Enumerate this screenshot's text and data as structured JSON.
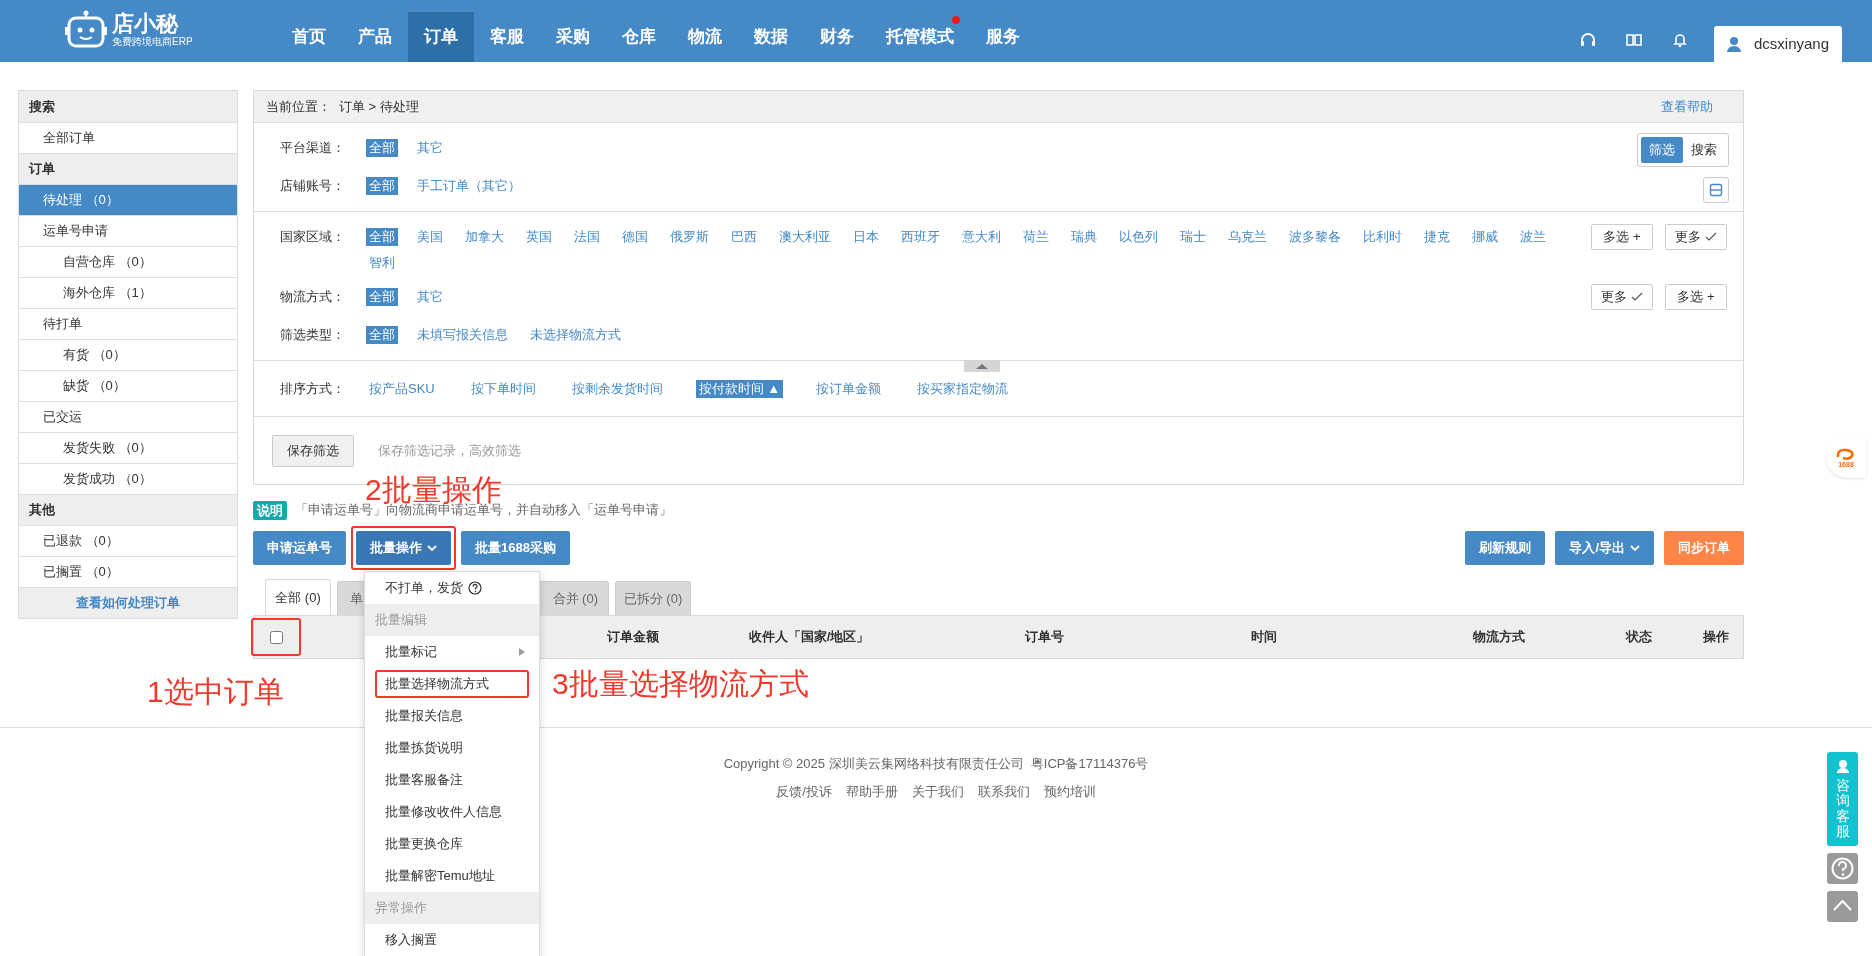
{
  "header": {
    "logo": {
      "name": "店小秘",
      "tagline": "免费跨境电商ERP"
    },
    "nav": [
      {
        "label": "首页",
        "selected": false,
        "dot": false
      },
      {
        "label": "产品",
        "selected": false,
        "dot": false
      },
      {
        "label": "订单",
        "selected": true,
        "dot": false
      },
      {
        "label": "客服",
        "selected": false,
        "dot": false
      },
      {
        "label": "采购",
        "selected": false,
        "dot": false
      },
      {
        "label": "仓库",
        "selected": false,
        "dot": false
      },
      {
        "label": "物流",
        "selected": false,
        "dot": false
      },
      {
        "label": "数据",
        "selected": false,
        "dot": false
      },
      {
        "label": "财务",
        "selected": false,
        "dot": false
      },
      {
        "label": "托管模式",
        "selected": false,
        "dot": true
      },
      {
        "label": "服务",
        "selected": false,
        "dot": false
      }
    ],
    "user": "dcsxinyang"
  },
  "sidebar": {
    "sections": [
      {
        "title": "搜索",
        "items": [
          {
            "label": "全部订单",
            "selected": false
          }
        ]
      },
      {
        "title": "订单",
        "items": [
          {
            "label": "待处理 （0）",
            "selected": true
          },
          {
            "label": "运单号申请",
            "selected": false,
            "children": [
              {
                "label": "自营仓库 （0）",
                "selected": false
              },
              {
                "label": "海外仓库 （1）",
                "selected": false
              }
            ]
          },
          {
            "label": "待打单",
            "selected": false,
            "children": [
              {
                "label": "有货 （0）",
                "selected": false
              },
              {
                "label": "缺货 （0）",
                "selected": false
              }
            ]
          },
          {
            "label": "已交运",
            "selected": false,
            "children": [
              {
                "label": "发货失败 （0）",
                "selected": false
              },
              {
                "label": "发货成功 （0）",
                "selected": false
              }
            ]
          }
        ]
      },
      {
        "title": "其他",
        "items": [
          {
            "label": "已退款 （0）",
            "selected": false
          },
          {
            "label": "已搁置 （0）",
            "selected": false
          }
        ]
      }
    ],
    "help_link": "查看如何处理订单"
  },
  "breadcrumb": {
    "label": "当前位置：",
    "path": "订单 > 待处理",
    "help": "查看帮助"
  },
  "view_toggle": [
    {
      "label": "筛选",
      "selected": true
    },
    {
      "label": "搜索",
      "selected": false
    }
  ],
  "filter_groups": [
    [
      {
        "label": "平台渠道：",
        "options": [
          {
            "label": "全部",
            "selected": true
          },
          {
            "label": "其它",
            "selected": false
          }
        ]
      },
      {
        "label": "店铺账号：",
        "options": [
          {
            "label": "全部",
            "selected": true
          },
          {
            "label": "手工订单（其它）",
            "selected": false
          }
        ]
      }
    ],
    [
      {
        "label": "国家区域：",
        "options": [
          {
            "label": "全部",
            "selected": true
          },
          {
            "label": "美国",
            "selected": false
          },
          {
            "label": "加拿大",
            "selected": false
          },
          {
            "label": "英国",
            "selected": false
          },
          {
            "label": "法国",
            "selected": false
          },
          {
            "label": "德国",
            "selected": false
          },
          {
            "label": "俄罗斯",
            "selected": false
          },
          {
            "label": "巴西",
            "selected": false
          },
          {
            "label": "澳大利亚",
            "selected": false
          },
          {
            "label": "日本",
            "selected": false
          },
          {
            "label": "西班牙",
            "selected": false
          },
          {
            "label": "意大利",
            "selected": false
          },
          {
            "label": "荷兰",
            "selected": false
          },
          {
            "label": "瑞典",
            "selected": false
          },
          {
            "label": "以色列",
            "selected": false
          },
          {
            "label": "瑞士",
            "selected": false
          },
          {
            "label": "乌克兰",
            "selected": false
          },
          {
            "label": "波多黎各",
            "selected": false
          },
          {
            "label": "比利时",
            "selected": false
          },
          {
            "label": "捷克",
            "selected": false
          },
          {
            "label": "挪威",
            "selected": false
          },
          {
            "label": "波兰",
            "selected": false
          },
          {
            "label": "智利",
            "selected": false
          }
        ],
        "buttons": [
          {
            "label": "多选 +",
            "kind": "multi"
          },
          {
            "label": "更多",
            "kind": "more"
          }
        ]
      },
      {
        "label": "物流方式：",
        "options": [
          {
            "label": "全部",
            "selected": true
          },
          {
            "label": "其它",
            "selected": false
          }
        ],
        "buttons": [
          {
            "label": "更多",
            "kind": "more"
          },
          {
            "label": "多选 +",
            "kind": "multi"
          }
        ]
      },
      {
        "label": "筛选类型：",
        "options": [
          {
            "label": "全部",
            "selected": true
          },
          {
            "label": "未填写报关信息",
            "selected": false
          },
          {
            "label": "未选择物流方式",
            "selected": false
          }
        ]
      }
    ]
  ],
  "sort": {
    "label": "排序方式：",
    "options": [
      {
        "label": "按产品SKU",
        "selected": false
      },
      {
        "label": "按下单时间",
        "selected": false
      },
      {
        "label": "按剩余发货时间",
        "selected": false
      },
      {
        "label": "按付款时间 ▲",
        "selected": true
      },
      {
        "label": "按订单金额",
        "selected": false
      },
      {
        "label": "按买家指定物流",
        "selected": false
      }
    ]
  },
  "save_filter": {
    "button": "保存筛选",
    "hint": "保存筛选记录，高效筛选"
  },
  "notice": {
    "tag": "说明",
    "text": "「申请运单号」向物流商申请运单号，并自动移入「运单号申请」"
  },
  "actions_left": [
    {
      "label": "申请运单号",
      "kind": "plain",
      "highlighted": false
    },
    {
      "label": "批量操作",
      "kind": "dropdown",
      "highlighted": true
    },
    {
      "label": "批量1688采购",
      "kind": "plain",
      "highlighted": false
    }
  ],
  "actions_right": [
    {
      "label": "刷新规则",
      "kind": "plain",
      "highlighted": false
    },
    {
      "label": "导入/导出",
      "kind": "dropdown",
      "highlighted": false
    },
    {
      "label": "同步订单",
      "kind": "accent",
      "highlighted": false
    }
  ],
  "tabs": [
    {
      "label": "全部 (0)",
      "selected": true
    },
    {
      "label": "单",
      "selected": false
    },
    {
      "label": "合并 (0)",
      "selected": false
    },
    {
      "label": "已拆分 (0)",
      "selected": false
    }
  ],
  "table": {
    "select_all": {
      "checked": false,
      "highlighted": true
    },
    "columns": [
      "订单金额",
      "收件人「国家/地区」",
      "订单号",
      "时间",
      "物流方式",
      "状态",
      "操作"
    ]
  },
  "dropdown_menu": [
    {
      "kind": "item",
      "label": "不打单，发货",
      "help": true,
      "submenu": false,
      "highlighted": false
    },
    {
      "kind": "header",
      "label": "批量编辑"
    },
    {
      "kind": "item",
      "label": "批量标记",
      "help": false,
      "submenu": true,
      "highlighted": false
    },
    {
      "kind": "item",
      "label": "批量选择物流方式",
      "help": false,
      "submenu": false,
      "highlighted": true
    },
    {
      "kind": "item",
      "label": "批量报关信息",
      "help": false,
      "submenu": false,
      "highlighted": false
    },
    {
      "kind": "item",
      "label": "批量拣货说明",
      "help": false,
      "submenu": false,
      "highlighted": false
    },
    {
      "kind": "item",
      "label": "批量客服备注",
      "help": false,
      "submenu": false,
      "highlighted": false
    },
    {
      "kind": "item",
      "label": "批量修改收件人信息",
      "help": false,
      "submenu": false,
      "highlighted": false
    },
    {
      "kind": "item",
      "label": "批量更换仓库",
      "help": false,
      "submenu": false,
      "highlighted": false
    },
    {
      "kind": "item",
      "label": "批量解密Temu地址",
      "help": false,
      "submenu": false,
      "highlighted": false
    },
    {
      "kind": "header",
      "label": "异常操作"
    },
    {
      "kind": "item",
      "label": "移入搁置",
      "help": false,
      "submenu": false,
      "highlighted": false
    }
  ],
  "annotations": [
    "1选中订单",
    "2批量操作",
    "3批量选择物流方式"
  ],
  "footer": {
    "copyright": "Copyright © 2025 深圳美云集网络科技有限责任公司  粤ICP备17114376号",
    "links": [
      "反馈/投诉",
      "帮助手册",
      "关于我们",
      "联系我们",
      "预约培训"
    ]
  },
  "side_widgets": {
    "badge": "1688",
    "service": "咨询客服"
  }
}
